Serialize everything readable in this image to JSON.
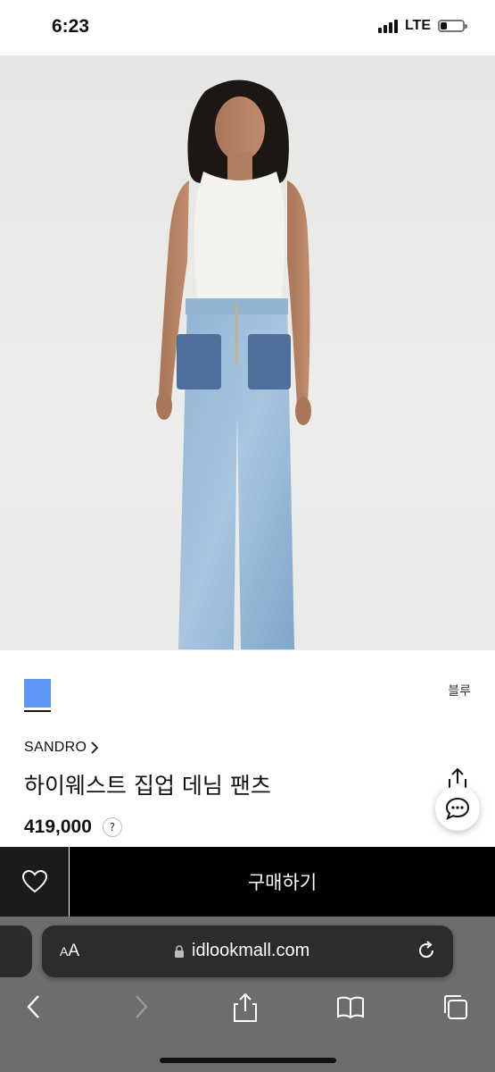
{
  "status": {
    "time": "6:23",
    "network": "LTE"
  },
  "product": {
    "color_name": "블루",
    "color_hex": "#5b95f5",
    "brand": "SANDRO",
    "title": "하이웨스트 집업 데님 팬츠",
    "price": "419,000",
    "price_help": "?"
  },
  "actions": {
    "buy_label": "구매하기"
  },
  "browser": {
    "aa_small": "A",
    "aa_big": "A",
    "url": "idlookmall.com"
  },
  "icons": [
    "heart-icon",
    "share-icon",
    "chat-icon",
    "lock-icon",
    "reload-icon",
    "back-icon",
    "forward-icon",
    "bookmarks-icon",
    "tabs-icon"
  ]
}
